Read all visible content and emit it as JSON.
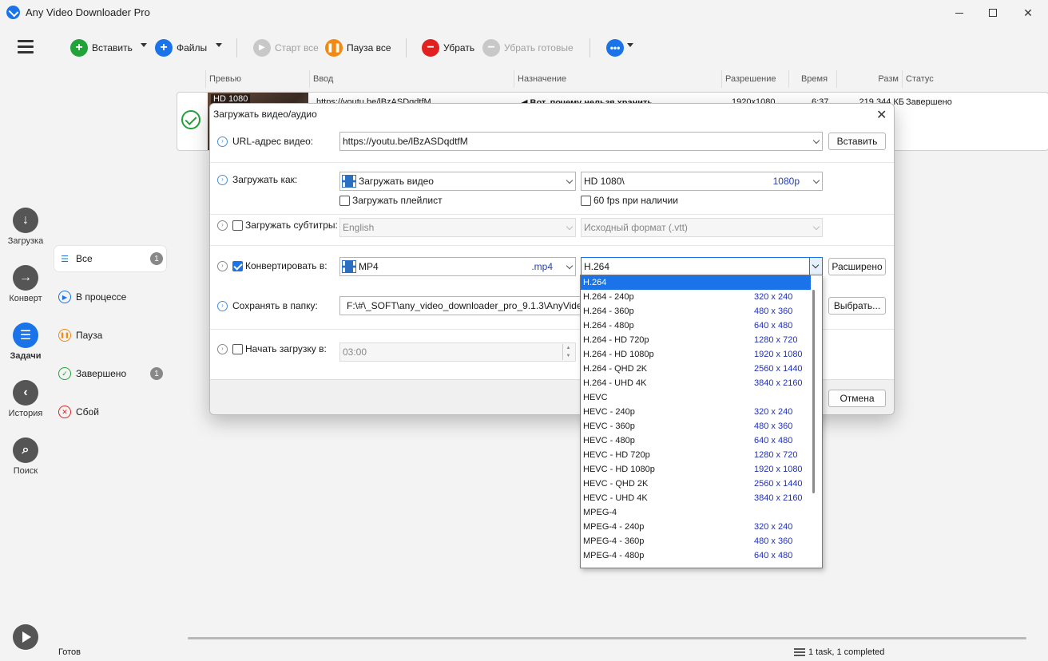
{
  "window": {
    "title": "Any Video Downloader Pro"
  },
  "nav": {
    "items": [
      {
        "label": "Загрузка",
        "icon": "arrow-down-icon"
      },
      {
        "label": "Конверт",
        "icon": "arrow-right-icon"
      },
      {
        "label": "Задачи",
        "icon": "tasks-icon"
      },
      {
        "label": "История",
        "icon": "arrow-left-icon"
      },
      {
        "label": "Поиск",
        "icon": "search-icon"
      }
    ]
  },
  "toolbar": {
    "paste": "Вставить",
    "files": "Файлы",
    "start_all": "Старт все",
    "pause_all": "Пауза все",
    "remove": "Убрать",
    "remove_done": "Убрать готовые"
  },
  "categories": [
    {
      "label": "Все",
      "count": "1"
    },
    {
      "label": "В процессе"
    },
    {
      "label": "Пауза"
    },
    {
      "label": "Завершено",
      "count": "1"
    },
    {
      "label": "Сбой"
    }
  ],
  "columns": [
    "Превью",
    "Ввод",
    "Назначение",
    "Разрешение",
    "Время",
    "Разм",
    "Статус"
  ],
  "task": {
    "thumb_label": "HD 1080",
    "input": "https://youtu.be/lBzASDqdtfM",
    "dest": "◀ Вот, почему нельзя хранить",
    "resolution": "1920x1080",
    "time": "6:37",
    "size": "219 344 КБ",
    "status": "Завершено"
  },
  "status": {
    "ready": "Готов",
    "summary": "1 task, 1 completed"
  },
  "dialog": {
    "title": "Загружать видео/аудио",
    "url_label": "URL-адрес видео:",
    "url_value": "https://youtu.be/lBzASDqdtfM",
    "paste_btn": "Вставить",
    "download_as_label": "Загружать как:",
    "download_as_value": "Загружать видео",
    "quality_value": "HD 1080\\",
    "quality_tag": "1080p",
    "playlist_label": "Загружать плейлист",
    "fps_label": "60 fps при наличии",
    "subs_label": "Загружать субтитры:",
    "subs_lang": "English",
    "subs_format": "Исходный формат (.vtt)",
    "convert_label": "Конвертировать в:",
    "convert_format": "MP4",
    "convert_ext": ".mp4",
    "codec_value": "H.264",
    "advanced_btn": "Расширено",
    "save_label": "Сохранять в папку:",
    "save_path": "F:\\#\\_SOFT\\any_video_downloader_pro_9.1.3\\AnyVideoD",
    "browse_btn": "Выбрать...",
    "start_label": "Начать загрузку в:",
    "start_time": "03:00",
    "cancel_btn": "Отмена"
  },
  "codec_options": [
    {
      "name": "H.264",
      "res": ""
    },
    {
      "name": "H.264 - 240p",
      "res": "320 x 240"
    },
    {
      "name": "H.264 - 360p",
      "res": "480 x 360"
    },
    {
      "name": "H.264 - 480p",
      "res": "640 x 480"
    },
    {
      "name": "H.264 - HD 720p",
      "res": "1280 x 720"
    },
    {
      "name": "H.264 - HD 1080p",
      "res": "1920 x 1080"
    },
    {
      "name": "H.264 - QHD 2K",
      "res": "2560 x 1440"
    },
    {
      "name": "H.264 - UHD 4K",
      "res": "3840 x 2160"
    },
    {
      "name": "HEVC",
      "res": ""
    },
    {
      "name": "HEVC - 240p",
      "res": "320 x 240"
    },
    {
      "name": "HEVC - 360p",
      "res": "480 x 360"
    },
    {
      "name": "HEVC - 480p",
      "res": "640 x 480"
    },
    {
      "name": "HEVC - HD 720p",
      "res": "1280 x 720"
    },
    {
      "name": "HEVC - HD 1080p",
      "res": "1920 x 1080"
    },
    {
      "name": "HEVC - QHD 2K",
      "res": "2560 x 1440"
    },
    {
      "name": "HEVC - UHD 4K",
      "res": "3840 x 2160"
    },
    {
      "name": "MPEG-4",
      "res": ""
    },
    {
      "name": "MPEG-4 - 240p",
      "res": "320 x 240"
    },
    {
      "name": "MPEG-4 - 360p",
      "res": "480 x 360"
    },
    {
      "name": "MPEG-4 - 480p",
      "res": "640 x 480"
    }
  ],
  "selected_codec": "H.264",
  "colors": {
    "accent": "#1a73e8",
    "add": "#21a33a",
    "pause": "#f08a12",
    "remove": "#e32020"
  }
}
